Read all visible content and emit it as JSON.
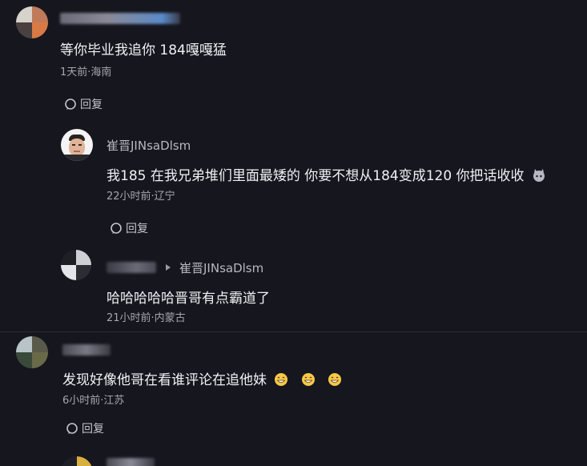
{
  "comments": [
    {
      "content": "等你毕业我追你 184嘎嘎猛",
      "meta": "1天前·海南",
      "reply_label": "回复"
    },
    {
      "username": "崔晋JINsaDlsm",
      "content": "我185 在我兄弟堆们里面最矮的 你要不想从184变成120 你把话收收",
      "meta": "22小时前·辽宁",
      "reply_label": "回复"
    },
    {
      "reply_to": "崔晋JINsaDlsm",
      "content": "哈哈哈哈哈晋哥有点霸道了",
      "meta": "21小时前·内蒙古"
    },
    {
      "content": "发现好像他哥在看谁评论在追他妹",
      "meta": "6小时前·江苏",
      "reply_label": "回复"
    }
  ],
  "icons": {
    "reply": "reply-bubble-icon",
    "emoji": "grin-emoji-icon"
  },
  "colors": {
    "background": "#16161e",
    "text": "#f0f0f4",
    "meta": "#a6a6b0"
  }
}
